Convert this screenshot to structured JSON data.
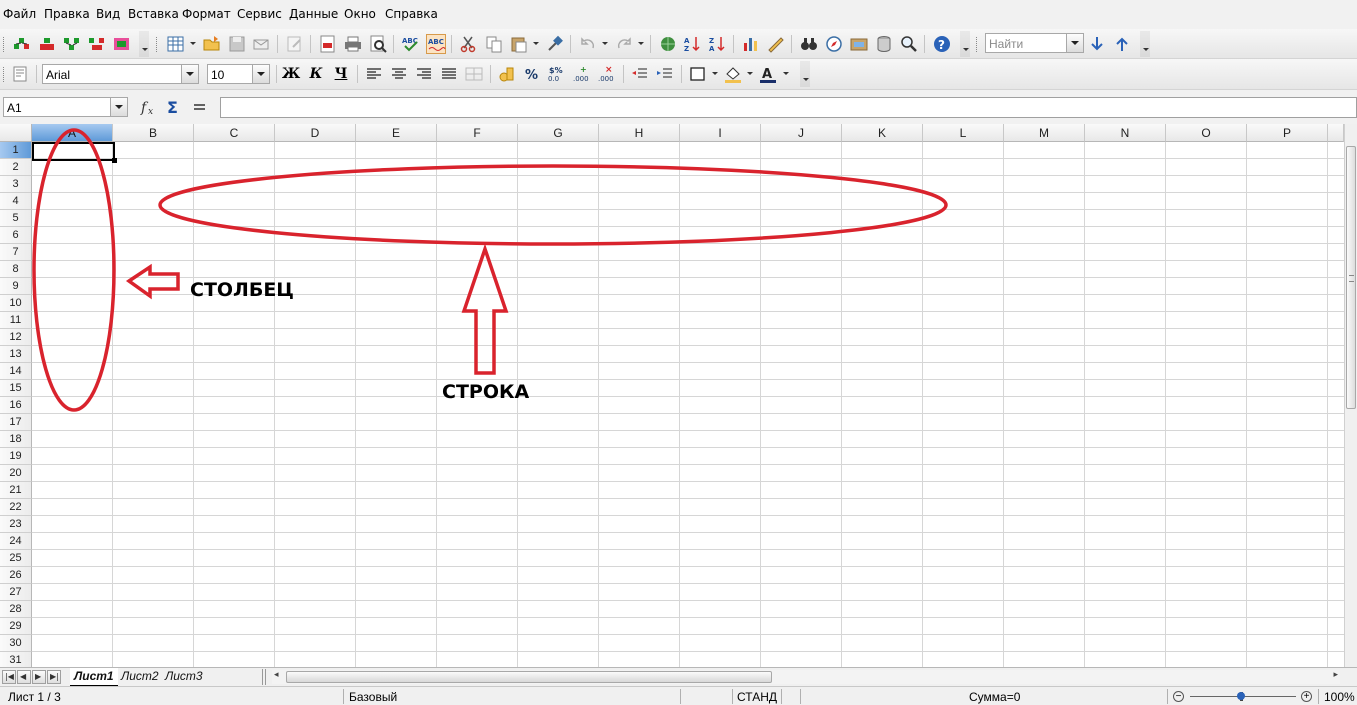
{
  "menu": {
    "items": [
      "Файл",
      "Правка",
      "Вид",
      "Вставка",
      "Формат",
      "Сервис",
      "Данные",
      "Окно",
      "Справка"
    ]
  },
  "toolbar1": {
    "find_placeholder": "Найти",
    "icons": [
      "insert-object-icon",
      "open-icon",
      "save-icon",
      "email-icon",
      "edit-file-icon",
      "pdf-export-icon",
      "print-icon",
      "print-preview-icon",
      "spellcheck-icon",
      "autospellcheck-icon",
      "cut-icon",
      "copy-icon",
      "paste-icon",
      "clone-format-icon",
      "undo-icon",
      "redo-icon",
      "hyperlink-icon",
      "sort-ascending-icon",
      "sort-descending-icon",
      "chart-icon",
      "draw-icon",
      "navigator-icon",
      "gallery-icon",
      "data-sources-icon",
      "zoom-icon",
      "help-icon",
      "find-next-icon",
      "find-previous-icon"
    ]
  },
  "toolbar2": {
    "font_name": "Arial",
    "font_size": "10",
    "bold_label": "Ж",
    "italic_label": "К",
    "underline_label": "Ч"
  },
  "formula": {
    "name_box": "A1",
    "input_value": ""
  },
  "grid": {
    "columns": [
      "A",
      "B",
      "C",
      "D",
      "E",
      "F",
      "G",
      "H",
      "I",
      "J",
      "K",
      "L",
      "M",
      "N",
      "O",
      "P"
    ],
    "rows": [
      "1",
      "2",
      "3",
      "4",
      "5",
      "6",
      "7",
      "8",
      "9",
      "10",
      "11",
      "12",
      "13",
      "14",
      "15",
      "16",
      "17",
      "18",
      "19",
      "20",
      "21",
      "22",
      "23",
      "24",
      "25",
      "26",
      "27",
      "28",
      "29",
      "30",
      "31"
    ],
    "selected_cell": "A1"
  },
  "sheets": {
    "tabs": [
      "Лист1",
      "Лист2",
      "Лист3"
    ],
    "active": "Лист1"
  },
  "status": {
    "sheet_info": "Лист 1 / 3",
    "page_style": "Базовый",
    "mode": "СТАНД",
    "sum": "Сумма=0",
    "zoom": "100%"
  },
  "annotations": {
    "column_label": "СТОЛБЕЦ",
    "row_label": "СТРОКА",
    "color": "#d9232d"
  }
}
